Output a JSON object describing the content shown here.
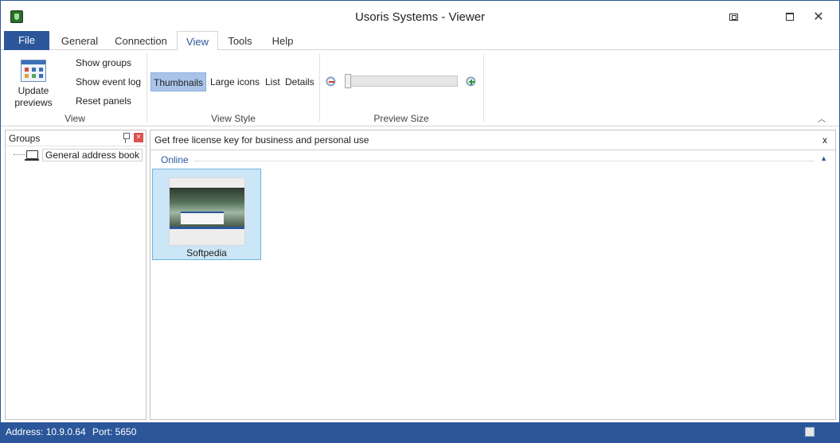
{
  "window": {
    "title": "Usoris Systems - Viewer"
  },
  "tabs": {
    "file": "File",
    "general": "General",
    "connection": "Connection",
    "view": "View",
    "tools": "Tools",
    "help": "Help"
  },
  "ribbon": {
    "view_group": {
      "update_previews_line1": "Update",
      "update_previews_line2": "previews",
      "show_groups": "Show groups",
      "show_event_log": "Show event log",
      "reset_panels": "Reset panels",
      "label": "View"
    },
    "view_style_group": {
      "thumbnails": "Thumbnails",
      "large_icons": "Large icons",
      "list": "List",
      "details": "Details",
      "label": "View Style",
      "selected": "Thumbnails"
    },
    "preview_size_group": {
      "label": "Preview Size",
      "slider_level": 0.0
    }
  },
  "groups_panel": {
    "title": "Groups",
    "tree": [
      {
        "label": "General address book"
      }
    ]
  },
  "main": {
    "info_bar": "Get free license key for business and personal use",
    "info_close": "x",
    "section": "Online",
    "thumbnails": [
      {
        "label": "Softpedia"
      }
    ]
  },
  "statusbar": {
    "address": "Address: 10.9.0.64",
    "port": "Port: 5650"
  },
  "colors": {
    "accent": "#2b579a",
    "selection": "#cbe6f7"
  },
  "icons": [
    "app-icon",
    "restore-icon",
    "maximize-icon",
    "close-icon",
    "update-previews-icon",
    "zoom-out-icon",
    "zoom-in-icon",
    "pin-icon",
    "close-panel-icon",
    "computer-icon"
  ]
}
